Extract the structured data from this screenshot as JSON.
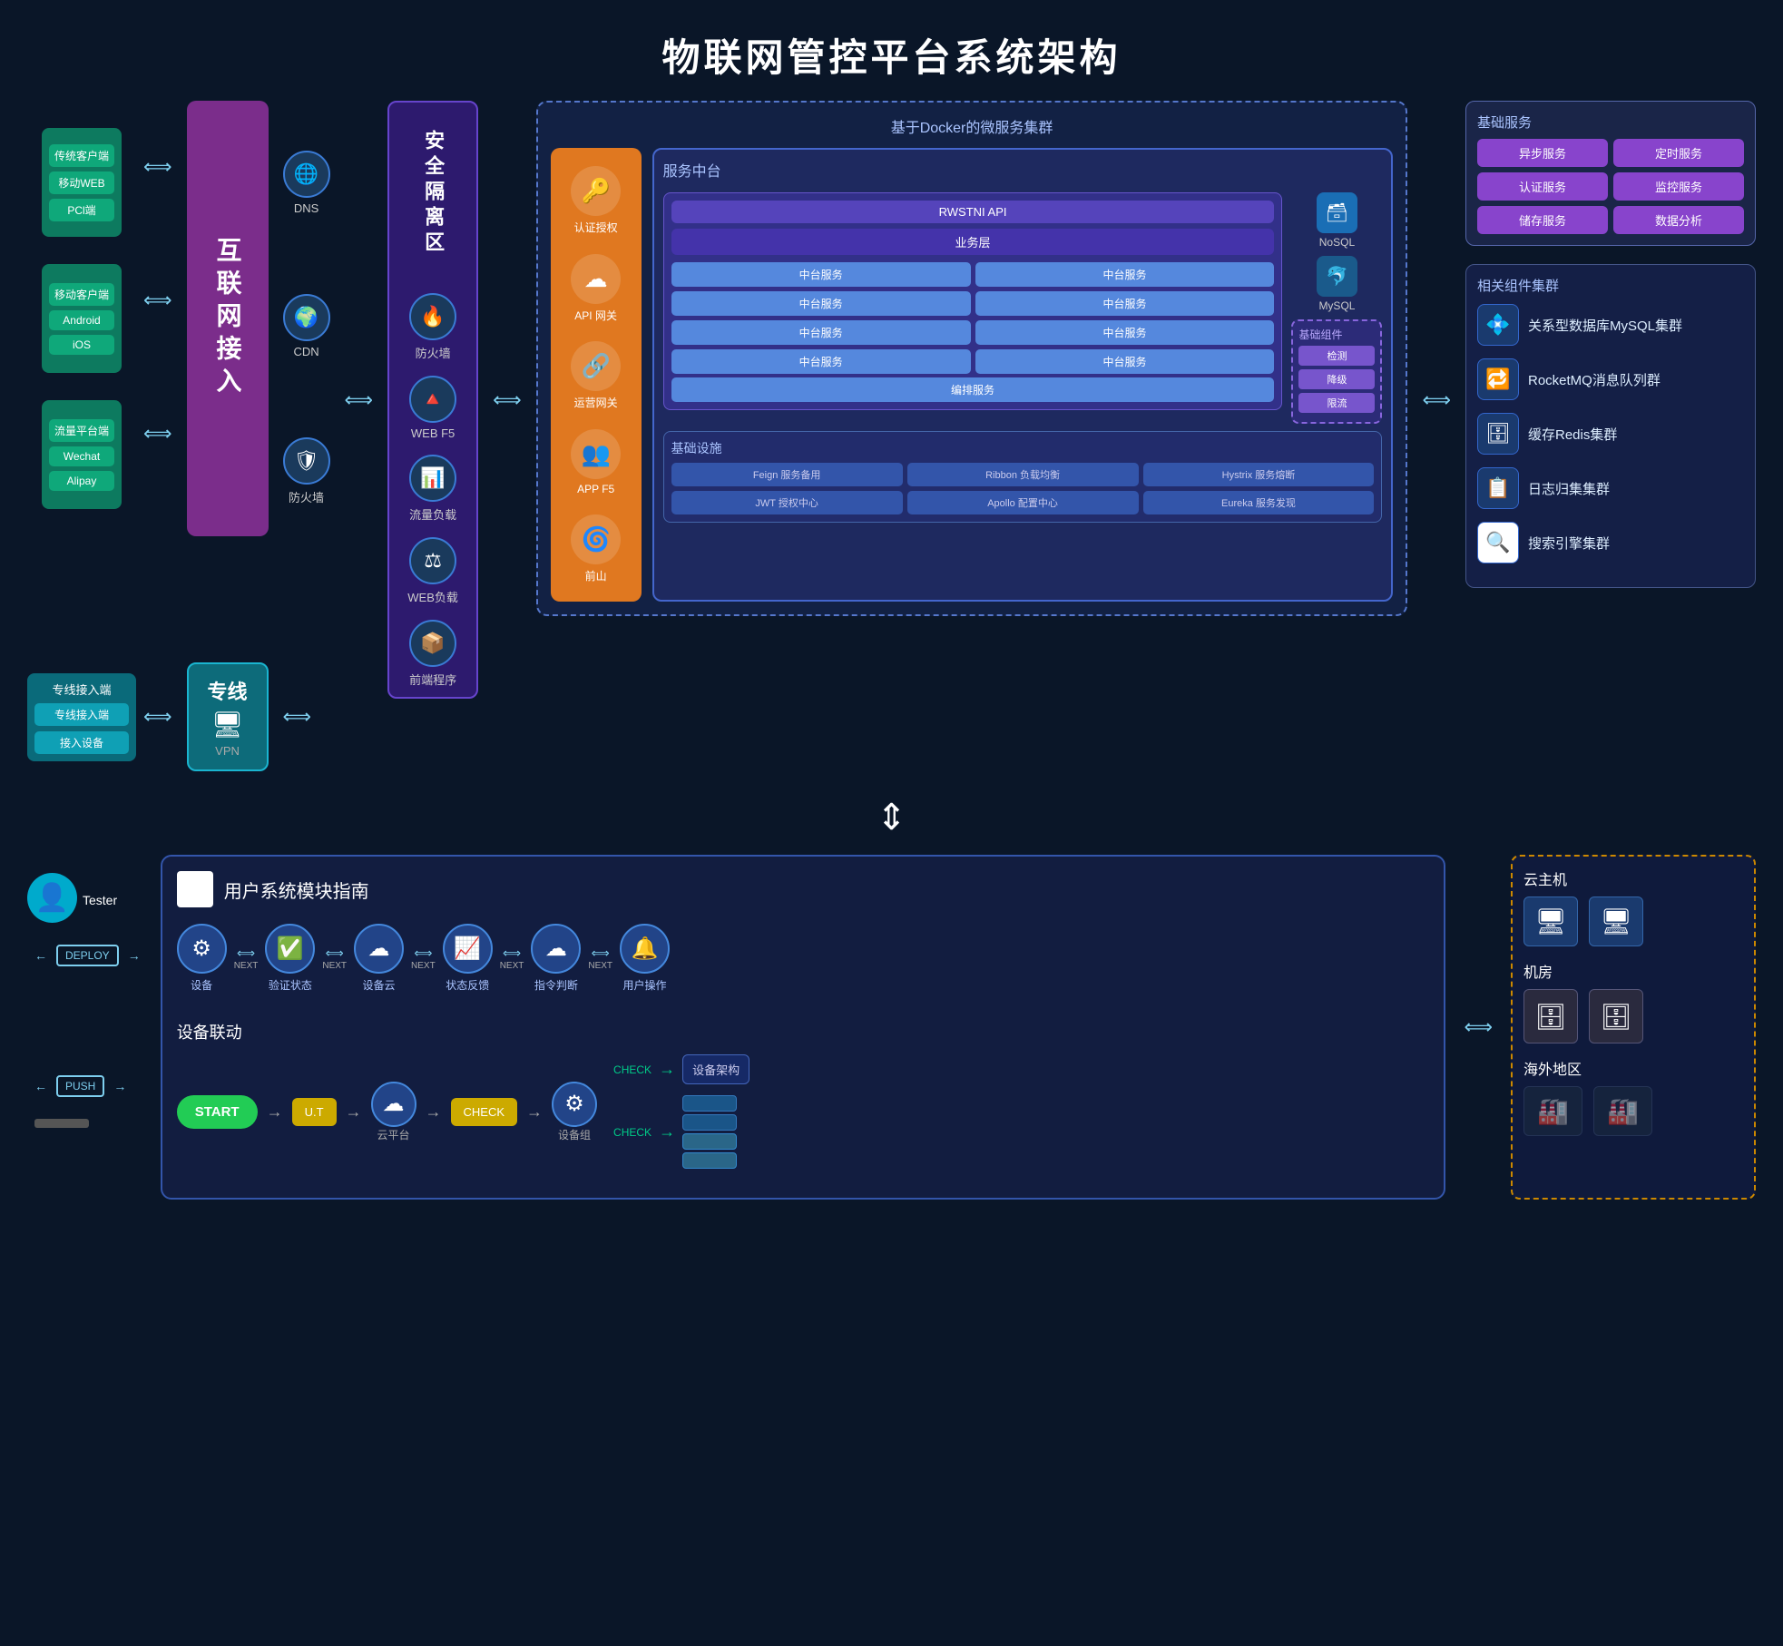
{
  "title": "物联网管控平台系统架构",
  "top": {
    "client_groups": [
      {
        "name": "传统客户端",
        "items": [
          "传统客户端",
          "移动WEB",
          "PCl端"
        ]
      },
      {
        "name": "移动客户端",
        "items": [
          "移动客户端",
          "Android",
          "iOS"
        ]
      },
      {
        "name": "流量平台端",
        "items": [
          "流量平台端",
          "Wechat",
          "Alipay"
        ]
      }
    ],
    "internet_label": "互联网接入",
    "net_services": [
      {
        "label": "DNS",
        "icon": "🌐"
      },
      {
        "label": "CDN",
        "icon": "🌍"
      },
      {
        "label": "防火墙",
        "icon": "🛡"
      }
    ],
    "security_zone_label": "安全隔离区",
    "security_items": [
      {
        "label": "防火墙",
        "icon": "🔥"
      },
      {
        "label": "WEB F5",
        "icon": "🔺"
      },
      {
        "label": "流量负载",
        "icon": "📊"
      },
      {
        "label": "WEB负载",
        "icon": "⚖"
      },
      {
        "label": "前端程序",
        "icon": "📦"
      }
    ],
    "docker_title": "基于Docker的微服务集群",
    "service_platform_title": "服务中台",
    "gateway_items": [
      {
        "label": "认证授权",
        "icon": "🔑"
      },
      {
        "label": "API 网关",
        "icon": "☁"
      },
      {
        "label": "运营网关",
        "icon": "🔗"
      },
      {
        "label": "APP F5",
        "icon": "👥"
      },
      {
        "label": "前山",
        "icon": "🌀"
      }
    ],
    "rwstni_api": "RWSTNI API",
    "service_layer": "业务层",
    "nosql_label": "NoSQL",
    "mysql_label": "MySQL",
    "mid_services": [
      "中台服务",
      "中台服务",
      "中台服务",
      "中台服务",
      "中台服务",
      "中台服务",
      "中台服务",
      "中台服务"
    ],
    "base_components_title": "基础组件",
    "base_component_items": [
      "检测",
      "降级",
      "限流"
    ],
    "orchestrate_label": "编排服务",
    "infrastructure_title": "基础设施",
    "infra_items": [
      "Feign 服务备用",
      "Ribbon 负载均衡",
      "Hystrix 服务熔断",
      "JWT 授权中心",
      "Apollo 配置中心",
      "Eureka 服务发现"
    ],
    "basic_services": {
      "title": "基础服务",
      "items": [
        "异步服务",
        "定时服务",
        "认证服务",
        "监控服务",
        "储存服务",
        "数据分析"
      ]
    },
    "related_clusters": {
      "title": "相关组件集群",
      "items": [
        {
          "label": "关系型数据库MySQL集群",
          "icon": "💠"
        },
        {
          "label": "RocketMQ消息队列群",
          "icon": "🔁"
        },
        {
          "label": "缓存Redis集群",
          "icon": "🗄"
        },
        {
          "label": "日志归集集群",
          "icon": "📋"
        },
        {
          "label": "搜索引擎集群",
          "icon": "🔍"
        }
      ]
    }
  },
  "leased": {
    "group_label": "专线接入端",
    "items": [
      "专线接入端",
      "接入设备"
    ],
    "block_label": "专线",
    "vpn_label": "VPN"
  },
  "bottom": {
    "user_module_title": "用户系统模块指南",
    "flow_items": [
      {
        "label": "设备",
        "icon": "⚙"
      },
      {
        "label": "验证状态",
        "icon": "✅"
      },
      {
        "label": "设备云",
        "icon": "☁"
      },
      {
        "label": "状态反馈",
        "icon": "📈"
      },
      {
        "label": "指令判断",
        "icon": "☁"
      },
      {
        "label": "用户操作",
        "icon": "🔔"
      }
    ],
    "flow_arrows": [
      "NEXT",
      "NEXT",
      "NEXT",
      "NEXT",
      "NEXT"
    ],
    "device_section_title": "设备联动",
    "tester_label": "Tester",
    "deploy_label": "DEPLOY",
    "push_label": "PUSH",
    "start_label": "START",
    "ut_label": "U.T",
    "cloud_platform_label": "云平台",
    "check_label": "CHECK",
    "device_group_label": "设备组",
    "device_arch_label": "设备架构",
    "cloud_host_title": "云主机",
    "datacenter_title": "机房",
    "overseas_title": "海外地区"
  }
}
